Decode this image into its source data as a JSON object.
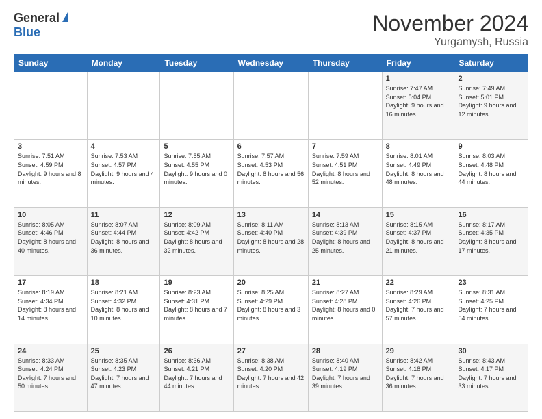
{
  "logo": {
    "general": "General",
    "blue": "Blue"
  },
  "header": {
    "month": "November 2024",
    "location": "Yurgamysh, Russia"
  },
  "weekdays": [
    "Sunday",
    "Monday",
    "Tuesday",
    "Wednesday",
    "Thursday",
    "Friday",
    "Saturday"
  ],
  "weeks": [
    [
      {
        "day": "",
        "info": ""
      },
      {
        "day": "",
        "info": ""
      },
      {
        "day": "",
        "info": ""
      },
      {
        "day": "",
        "info": ""
      },
      {
        "day": "",
        "info": ""
      },
      {
        "day": "1",
        "info": "Sunrise: 7:47 AM\nSunset: 5:04 PM\nDaylight: 9 hours and 16 minutes."
      },
      {
        "day": "2",
        "info": "Sunrise: 7:49 AM\nSunset: 5:01 PM\nDaylight: 9 hours and 12 minutes."
      }
    ],
    [
      {
        "day": "3",
        "info": "Sunrise: 7:51 AM\nSunset: 4:59 PM\nDaylight: 9 hours and 8 minutes."
      },
      {
        "day": "4",
        "info": "Sunrise: 7:53 AM\nSunset: 4:57 PM\nDaylight: 9 hours and 4 minutes."
      },
      {
        "day": "5",
        "info": "Sunrise: 7:55 AM\nSunset: 4:55 PM\nDaylight: 9 hours and 0 minutes."
      },
      {
        "day": "6",
        "info": "Sunrise: 7:57 AM\nSunset: 4:53 PM\nDaylight: 8 hours and 56 minutes."
      },
      {
        "day": "7",
        "info": "Sunrise: 7:59 AM\nSunset: 4:51 PM\nDaylight: 8 hours and 52 minutes."
      },
      {
        "day": "8",
        "info": "Sunrise: 8:01 AM\nSunset: 4:49 PM\nDaylight: 8 hours and 48 minutes."
      },
      {
        "day": "9",
        "info": "Sunrise: 8:03 AM\nSunset: 4:48 PM\nDaylight: 8 hours and 44 minutes."
      }
    ],
    [
      {
        "day": "10",
        "info": "Sunrise: 8:05 AM\nSunset: 4:46 PM\nDaylight: 8 hours and 40 minutes."
      },
      {
        "day": "11",
        "info": "Sunrise: 8:07 AM\nSunset: 4:44 PM\nDaylight: 8 hours and 36 minutes."
      },
      {
        "day": "12",
        "info": "Sunrise: 8:09 AM\nSunset: 4:42 PM\nDaylight: 8 hours and 32 minutes."
      },
      {
        "day": "13",
        "info": "Sunrise: 8:11 AM\nSunset: 4:40 PM\nDaylight: 8 hours and 28 minutes."
      },
      {
        "day": "14",
        "info": "Sunrise: 8:13 AM\nSunset: 4:39 PM\nDaylight: 8 hours and 25 minutes."
      },
      {
        "day": "15",
        "info": "Sunrise: 8:15 AM\nSunset: 4:37 PM\nDaylight: 8 hours and 21 minutes."
      },
      {
        "day": "16",
        "info": "Sunrise: 8:17 AM\nSunset: 4:35 PM\nDaylight: 8 hours and 17 minutes."
      }
    ],
    [
      {
        "day": "17",
        "info": "Sunrise: 8:19 AM\nSunset: 4:34 PM\nDaylight: 8 hours and 14 minutes."
      },
      {
        "day": "18",
        "info": "Sunrise: 8:21 AM\nSunset: 4:32 PM\nDaylight: 8 hours and 10 minutes."
      },
      {
        "day": "19",
        "info": "Sunrise: 8:23 AM\nSunset: 4:31 PM\nDaylight: 8 hours and 7 minutes."
      },
      {
        "day": "20",
        "info": "Sunrise: 8:25 AM\nSunset: 4:29 PM\nDaylight: 8 hours and 3 minutes."
      },
      {
        "day": "21",
        "info": "Sunrise: 8:27 AM\nSunset: 4:28 PM\nDaylight: 8 hours and 0 minutes."
      },
      {
        "day": "22",
        "info": "Sunrise: 8:29 AM\nSunset: 4:26 PM\nDaylight: 7 hours and 57 minutes."
      },
      {
        "day": "23",
        "info": "Sunrise: 8:31 AM\nSunset: 4:25 PM\nDaylight: 7 hours and 54 minutes."
      }
    ],
    [
      {
        "day": "24",
        "info": "Sunrise: 8:33 AM\nSunset: 4:24 PM\nDaylight: 7 hours and 50 minutes."
      },
      {
        "day": "25",
        "info": "Sunrise: 8:35 AM\nSunset: 4:23 PM\nDaylight: 7 hours and 47 minutes."
      },
      {
        "day": "26",
        "info": "Sunrise: 8:36 AM\nSunset: 4:21 PM\nDaylight: 7 hours and 44 minutes."
      },
      {
        "day": "27",
        "info": "Sunrise: 8:38 AM\nSunset: 4:20 PM\nDaylight: 7 hours and 42 minutes."
      },
      {
        "day": "28",
        "info": "Sunrise: 8:40 AM\nSunset: 4:19 PM\nDaylight: 7 hours and 39 minutes."
      },
      {
        "day": "29",
        "info": "Sunrise: 8:42 AM\nSunset: 4:18 PM\nDaylight: 7 hours and 36 minutes."
      },
      {
        "day": "30",
        "info": "Sunrise: 8:43 AM\nSunset: 4:17 PM\nDaylight: 7 hours and 33 minutes."
      }
    ]
  ]
}
